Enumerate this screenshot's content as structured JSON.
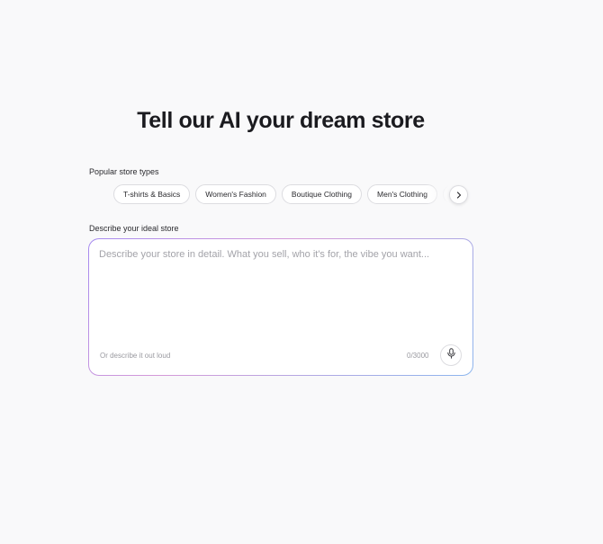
{
  "heading": "Tell our AI your dream store",
  "store_types": {
    "label": "Popular store types",
    "chips": [
      "T-shirts & Basics",
      "Women's Fashion",
      "Boutique Clothing",
      "Men's Clothing",
      ""
    ],
    "next_icon": "chevron-right-icon"
  },
  "description": {
    "label": "Describe your ideal store",
    "placeholder": "Describe your store in detail. What you sell, who it's for, the vibe you want...",
    "value": "",
    "hint": "Or describe it out loud",
    "counter": "0/3000",
    "mic_icon": "microphone-icon"
  },
  "colors": {
    "background": "#f9f9fa",
    "gradient_border": [
      "#a58af0",
      "#d59ad8",
      "#8cb6ee"
    ]
  }
}
